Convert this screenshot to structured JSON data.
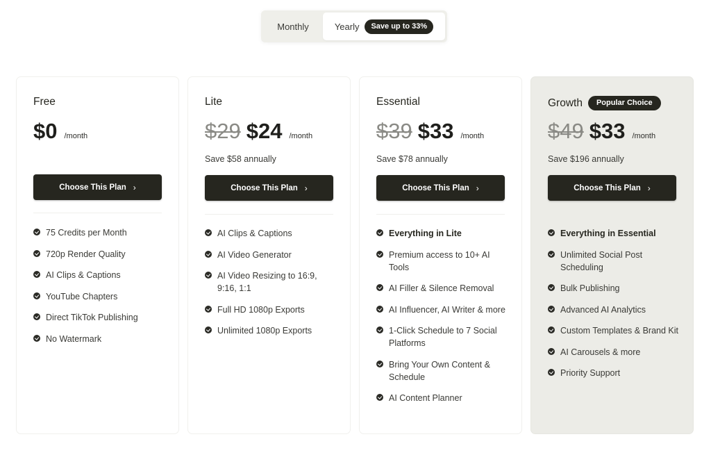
{
  "billing_toggle": {
    "monthly_label": "Monthly",
    "yearly_label": "Yearly",
    "yearly_badge": "Save up to 33%",
    "selected": "Yearly"
  },
  "plans": [
    {
      "name": "Free",
      "badge": null,
      "old_price": null,
      "price": "$0",
      "period": "/month",
      "savings": null,
      "cta_label": "Choose This Plan",
      "highlighted": false,
      "features": [
        {
          "text": "75 Credits per Month",
          "bold": false
        },
        {
          "text": "720p Render Quality",
          "bold": false
        },
        {
          "text": "AI Clips & Captions",
          "bold": false
        },
        {
          "text": "YouTube Chapters",
          "bold": false
        },
        {
          "text": "Direct TikTok Publishing",
          "bold": false
        },
        {
          "text": "No Watermark",
          "bold": false
        }
      ]
    },
    {
      "name": "Lite",
      "badge": null,
      "old_price": "$29",
      "price": "$24",
      "period": "/month",
      "savings": "Save $58 annually",
      "cta_label": "Choose This Plan",
      "highlighted": false,
      "features": [
        {
          "text": "AI Clips & Captions",
          "bold": false
        },
        {
          "text": "AI Video Generator",
          "bold": false
        },
        {
          "text": "AI Video Resizing to 16:9, 9:16, 1:1",
          "bold": false
        },
        {
          "text": "Full HD 1080p Exports",
          "bold": false
        },
        {
          "text": "Unlimited 1080p Exports",
          "bold": false
        }
      ]
    },
    {
      "name": "Essential",
      "badge": null,
      "old_price": "$39",
      "price": "$33",
      "period": "/month",
      "savings": "Save $78 annually",
      "cta_label": "Choose This Plan",
      "highlighted": false,
      "features": [
        {
          "text": "Everything in Lite",
          "bold": true
        },
        {
          "text": "Premium access to 10+ AI Tools",
          "bold": false
        },
        {
          "text": "AI Filler & Silence Removal",
          "bold": false
        },
        {
          "text": "AI Influencer, AI Writer & more",
          "bold": false
        },
        {
          "text": "1-Click Schedule to 7 Social Platforms",
          "bold": false
        },
        {
          "text": "Bring Your Own Content & Schedule",
          "bold": false
        },
        {
          "text": "AI Content Planner",
          "bold": false
        }
      ]
    },
    {
      "name": "Growth",
      "badge": "Popular Choice",
      "old_price": "$49",
      "price": "$33",
      "period": "/month",
      "savings": "Save $196 annually",
      "cta_label": "Choose This Plan",
      "highlighted": true,
      "features": [
        {
          "text": "Everything in Essential",
          "bold": true
        },
        {
          "text": "Unlimited Social Post Scheduling",
          "bold": false
        },
        {
          "text": "Bulk Publishing",
          "bold": false
        },
        {
          "text": "Advanced AI Analytics",
          "bold": false
        },
        {
          "text": "Custom Templates & Brand Kit",
          "bold": false
        },
        {
          "text": "AI Carousels & more",
          "bold": false
        },
        {
          "text": "Priority Support",
          "bold": false
        }
      ]
    }
  ],
  "icons": {
    "feature_check": "check-circle-icon",
    "cta_arrow": "chevron-right-icon"
  },
  "colors": {
    "primary_dark": "#26261f",
    "highlight_card_bg": "#ecece7",
    "strikethrough_price": "#8a8a85"
  }
}
